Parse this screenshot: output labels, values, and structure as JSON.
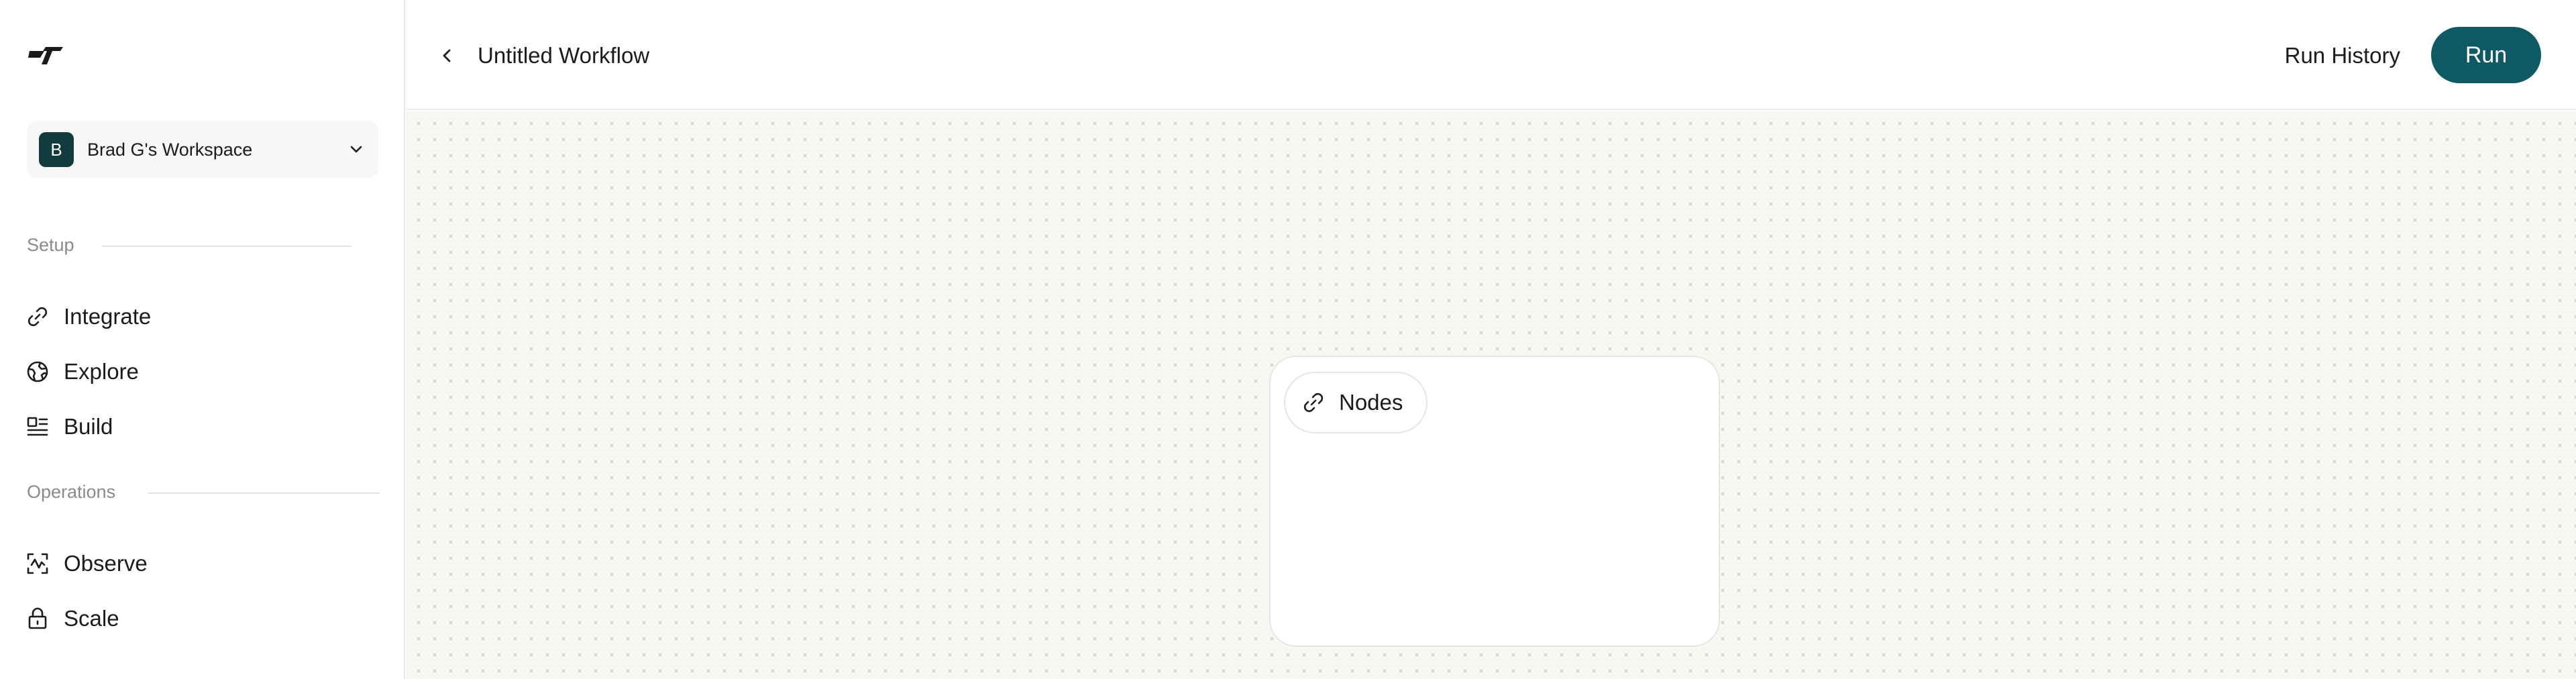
{
  "sidebar": {
    "workspace": {
      "avatar_letter": "B",
      "name": "Brad G's Workspace"
    },
    "sections": [
      {
        "label": "Setup",
        "items": [
          {
            "label": "Integrate",
            "icon": "link-icon"
          },
          {
            "label": "Explore",
            "icon": "globe-icon"
          },
          {
            "label": "Build",
            "icon": "layout-icon"
          }
        ]
      },
      {
        "label": "Operations",
        "items": [
          {
            "label": "Observe",
            "icon": "activity-frame-icon"
          },
          {
            "label": "Scale",
            "icon": "lock-icon"
          }
        ]
      }
    ]
  },
  "header": {
    "title": "Untitled Workflow",
    "run_history_label": "Run History",
    "run_label": "Run"
  },
  "canvas": {
    "nodes_chip_label": "Nodes"
  },
  "colors": {
    "accent": "#0e5a64",
    "avatar_bg": "#113b3d",
    "canvas_bg": "#f7f6f2"
  }
}
